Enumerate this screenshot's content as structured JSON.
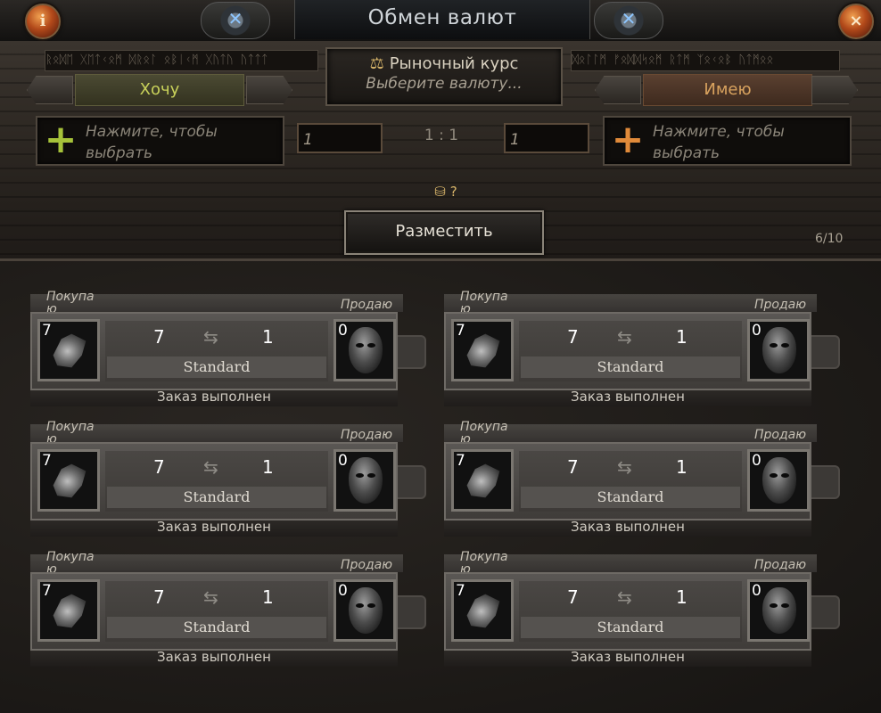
{
  "window": {
    "title": "Обмен валют",
    "info_glyph": "i",
    "close_glyph": "×",
    "gear_glyph": "✕"
  },
  "header": {
    "runes_left": "ᚱᛟᛞᛖ ᚷᛖᛏᚲᛟᛗ ᛞᚱᛟᛚ ᛟᛒᛁᚲᛗ ᚷᚢᛏᚢ ᚢᛏᛏᛏ",
    "runes_right": "ᛞᛟᛚᛚᛗ ᚠᛟᛞᛞᛋᛟᛗ ᚱᛏᛗ ᛉᛟᚲᛟᛒ ᚢᛏᛗᛟᛟ",
    "market_label": "Рыночный курс",
    "market_hint": "Выберите валюту...",
    "want_tab": "Хочу",
    "have_tab": "Имею",
    "want_hint": "Нажмите, чтобы выбрать",
    "have_hint": "Нажмите, чтобы выбрать",
    "want_qty": "1",
    "have_qty": "1",
    "ratio": "1 : 1",
    "coins_text": "?",
    "place_button": "Разместить",
    "slots": "6/10",
    "colors": {
      "want": "#c8d15a",
      "have": "#d8a25e",
      "plus_want": "#a6c23a",
      "plus_have": "#e08a3a"
    }
  },
  "orders": [
    {
      "buy_label": "Покупа ю",
      "sell_label": "Продаю",
      "get_count": "7",
      "want_amount": "7",
      "have_amount": "1",
      "give_count": "0",
      "league": "Standard",
      "status": "Заказ выполнен",
      "get_icon": "shard-icon",
      "give_icon": "mask-icon"
    },
    {
      "buy_label": "Покупа ю",
      "sell_label": "Продаю",
      "get_count": "7",
      "want_amount": "7",
      "have_amount": "1",
      "give_count": "0",
      "league": "Standard",
      "status": "Заказ выполнен",
      "get_icon": "shard-icon",
      "give_icon": "mask-icon"
    },
    {
      "buy_label": "Покупа ю",
      "sell_label": "Продаю",
      "get_count": "7",
      "want_amount": "7",
      "have_amount": "1",
      "give_count": "0",
      "league": "Standard",
      "status": "Заказ выполнен",
      "get_icon": "shard-icon",
      "give_icon": "mask-icon"
    },
    {
      "buy_label": "Покупа ю",
      "sell_label": "Продаю",
      "get_count": "7",
      "want_amount": "7",
      "have_amount": "1",
      "give_count": "0",
      "league": "Standard",
      "status": "Заказ выполнен",
      "get_icon": "shard-icon",
      "give_icon": "mask-icon"
    },
    {
      "buy_label": "Покупа ю",
      "sell_label": "Продаю",
      "get_count": "7",
      "want_amount": "7",
      "have_amount": "1",
      "give_count": "0",
      "league": "Standard",
      "status": "Заказ выполнен",
      "get_icon": "shard-icon",
      "give_icon": "mask-icon"
    },
    {
      "buy_label": "Покупа ю",
      "sell_label": "Продаю",
      "get_count": "7",
      "want_amount": "7",
      "have_amount": "1",
      "give_count": "0",
      "league": "Standard",
      "status": "Заказ выполнен",
      "get_icon": "shard-icon",
      "give_icon": "mask-icon"
    }
  ]
}
